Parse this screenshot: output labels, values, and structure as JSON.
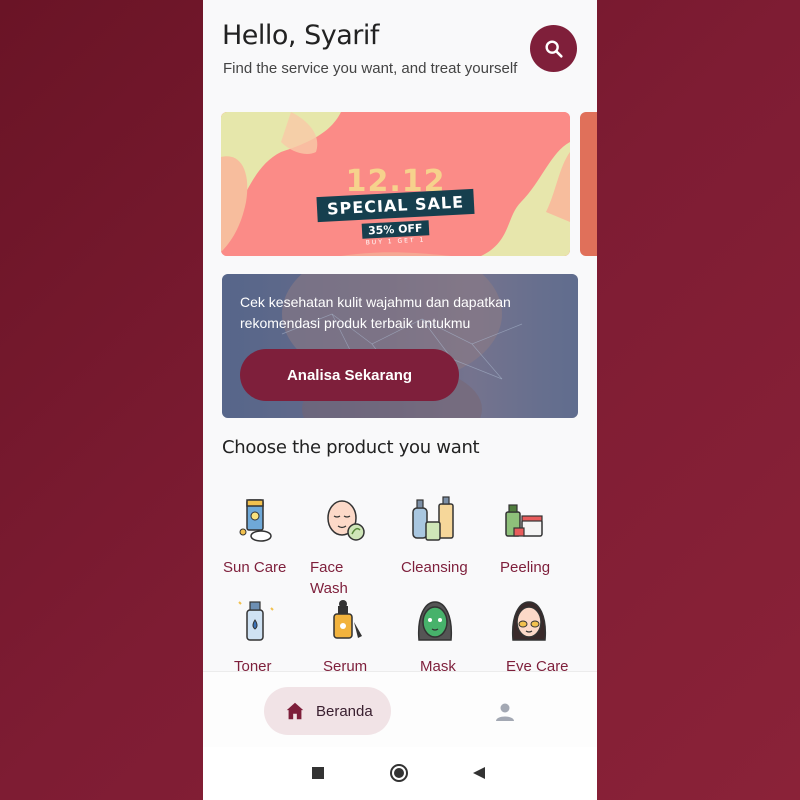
{
  "header": {
    "greeting": "Hello, Syarif",
    "subtitle": "Find the service you want, and treat yourself"
  },
  "promo_banner": {
    "number": "12.12",
    "title": "SPECIAL SALE",
    "discount": "35% OFF",
    "fine_print": "BUY 1 GET 1"
  },
  "analyze_card": {
    "text": "Cek kesehatan kulit wajahmu dan dapatkan rekomendasi produk terbaik untukmu",
    "button_label": "Analisa Sekarang"
  },
  "products": {
    "section_title": "Choose the product you want",
    "categories": [
      {
        "label": "Sun Care",
        "icon": "sunscreen-icon"
      },
      {
        "label": "Face\nWash",
        "icon": "face-wash-icon"
      },
      {
        "label": "Cleansing",
        "icon": "cleansing-bottles-icon"
      },
      {
        "label": "Peeling",
        "icon": "peeling-products-icon"
      },
      {
        "label": "Toner",
        "icon": "toner-bottle-icon"
      },
      {
        "label": "Serum",
        "icon": "serum-dropper-icon"
      },
      {
        "label": "Mask",
        "icon": "face-mask-icon"
      },
      {
        "label": "Eye Care",
        "icon": "eye-patch-icon"
      }
    ]
  },
  "bottom_nav": {
    "home_label": "Beranda"
  },
  "colors": {
    "brand": "#7e1f3b",
    "background": "#f9f9fa"
  }
}
